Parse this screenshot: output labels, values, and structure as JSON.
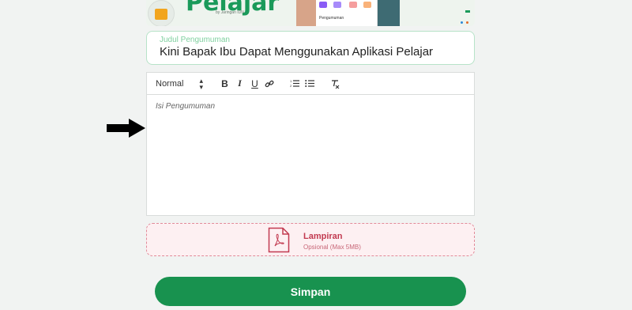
{
  "banner": {
    "title": "Pelajar",
    "subtitle": "by Jaringan IDN",
    "screen_label": "Pengumuman"
  },
  "form": {
    "title_label": "Judul Pengumuman",
    "title_value": "Kini Bapak Ibu Dapat Menggunakan Aplikasi Pelajar",
    "body_placeholder": "Isi Pengumuman"
  },
  "toolbar": {
    "format_select": "Normal",
    "bold": "B",
    "italic": "I",
    "underline": "U",
    "icons": [
      "link-icon",
      "ordered-list-icon",
      "bullet-list-icon",
      "clear-format-icon"
    ]
  },
  "attachment": {
    "label": "Lampiran",
    "hint": "Opsional (Max 5MB)",
    "icon": "pdf-file-icon"
  },
  "actions": {
    "save_label": "Simpan"
  },
  "colors": {
    "primary_green": "#18924f",
    "attachment_red": "#c23a50",
    "attachment_bg": "#fdf0f2",
    "label_green": "#7fd09f"
  }
}
